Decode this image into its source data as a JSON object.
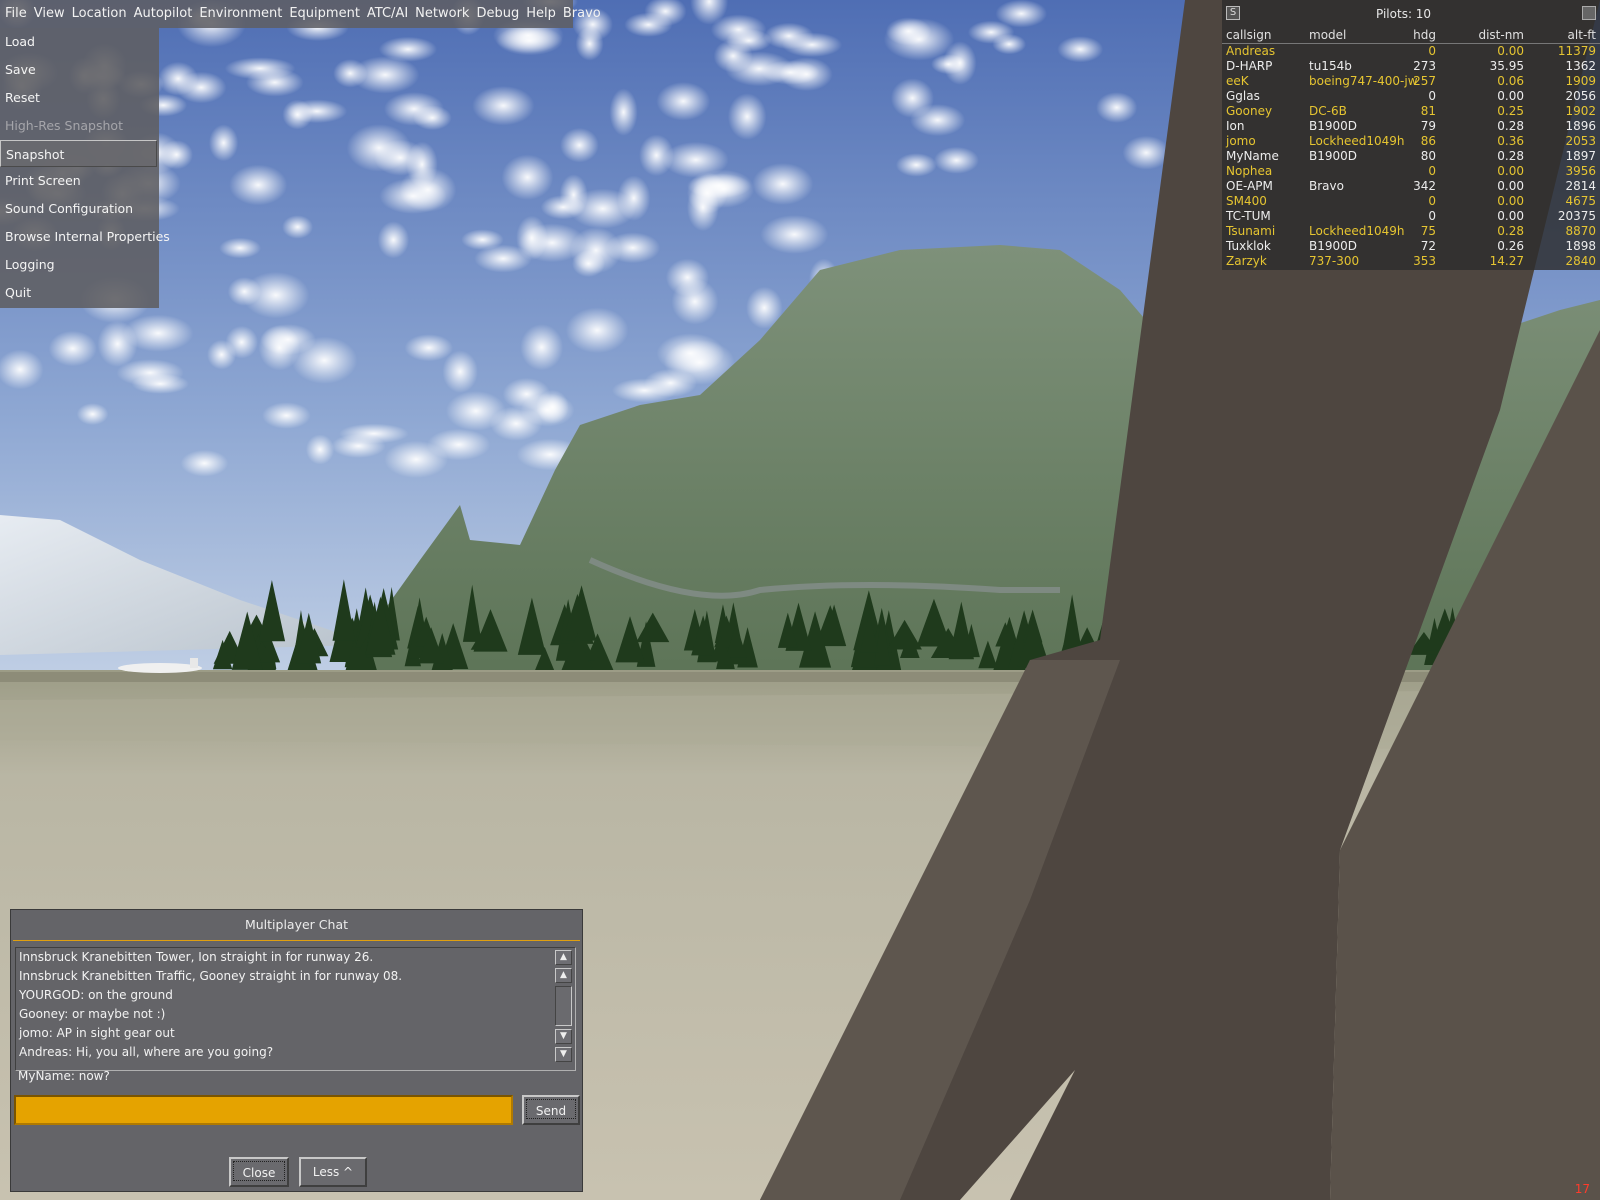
{
  "menubar": {
    "items": [
      "File",
      "View",
      "Location",
      "Autopilot",
      "Environment",
      "Equipment",
      "ATC/AI",
      "Network",
      "Debug",
      "Help",
      "Bravo"
    ]
  },
  "file_menu": {
    "items": [
      {
        "label": "Load",
        "state": "normal"
      },
      {
        "label": "Save",
        "state": "normal"
      },
      {
        "label": "Reset",
        "state": "normal"
      },
      {
        "label": "High-Res Snapshot",
        "state": "disabled"
      },
      {
        "label": "Snapshot",
        "state": "selected"
      },
      {
        "label": "Print Screen",
        "state": "normal"
      },
      {
        "label": "Sound Configuration",
        "state": "normal"
      },
      {
        "label": "Browse Internal Properties",
        "state": "normal"
      },
      {
        "label": "Logging",
        "state": "normal"
      },
      {
        "label": "Quit",
        "state": "normal"
      }
    ]
  },
  "pilots": {
    "title": "Pilots:  10",
    "columns": [
      "callsign",
      "model",
      "hdg",
      "dist-nm",
      "alt-ft"
    ],
    "rows": [
      {
        "callsign": "Andreas",
        "model": "",
        "hdg": "0",
        "dist": "0.00",
        "alt": "11379",
        "color": "yellow"
      },
      {
        "callsign": "D-HARP",
        "model": "tu154b",
        "hdg": "273",
        "dist": "35.95",
        "alt": "1362",
        "color": "white"
      },
      {
        "callsign": "eeK",
        "model": "boeing747-400-jw",
        "hdg": "257",
        "dist": "0.06",
        "alt": "1909",
        "color": "yellow"
      },
      {
        "callsign": "Gglas",
        "model": "",
        "hdg": "0",
        "dist": "0.00",
        "alt": "2056",
        "color": "white"
      },
      {
        "callsign": "Gooney",
        "model": "DC-6B",
        "hdg": "81",
        "dist": "0.25",
        "alt": "1902",
        "color": "yellow"
      },
      {
        "callsign": "Ion",
        "model": "B1900D",
        "hdg": "79",
        "dist": "0.28",
        "alt": "1896",
        "color": "white"
      },
      {
        "callsign": "jomo",
        "model": "Lockheed1049h",
        "hdg": "86",
        "dist": "0.36",
        "alt": "2053",
        "color": "yellow"
      },
      {
        "callsign": "MyName",
        "model": "B1900D",
        "hdg": "80",
        "dist": "0.28",
        "alt": "1897",
        "color": "white"
      },
      {
        "callsign": "Nophea",
        "model": "",
        "hdg": "0",
        "dist": "0.00",
        "alt": "3956",
        "color": "yellow"
      },
      {
        "callsign": "OE-APM",
        "model": "Bravo",
        "hdg": "342",
        "dist": "0.00",
        "alt": "2814",
        "color": "white"
      },
      {
        "callsign": "SM400",
        "model": "",
        "hdg": "0",
        "dist": "0.00",
        "alt": "4675",
        "color": "yellow"
      },
      {
        "callsign": "TC-TUM",
        "model": "",
        "hdg": "0",
        "dist": "0.00",
        "alt": "20375",
        "color": "white"
      },
      {
        "callsign": "Tsunami",
        "model": "Lockheed1049h",
        "hdg": "75",
        "dist": "0.28",
        "alt": "8870",
        "color": "yellow"
      },
      {
        "callsign": "Tuxklok",
        "model": "B1900D",
        "hdg": "72",
        "dist": "0.26",
        "alt": "1898",
        "color": "white"
      },
      {
        "callsign": "Zarzyk",
        "model": "737-300",
        "hdg": "353",
        "dist": "14.27",
        "alt": "2840",
        "color": "yellow"
      }
    ]
  },
  "chat": {
    "title": "Multiplayer Chat",
    "messages": [
      " Innsbruck Kranebitten Tower, Ion straight in for runway 26.",
      " Innsbruck Kranebitten Traffic, Gooney straight in for runway 08.",
      "YOURGOD: on the ground",
      "Gooney: or maybe not :)",
      "jomo: AP in sight gear out",
      "Andreas: Hi, you all, where are you going?"
    ],
    "prompt": "MyName: now?",
    "input_value": "",
    "send_label": "Send",
    "close_label": "Close",
    "less_label": "Less ^"
  },
  "fps": "17",
  "colors": {
    "accent": "#e5a300",
    "pilot_yellow": "#e6c531",
    "fps_red": "#ff3b2b"
  }
}
